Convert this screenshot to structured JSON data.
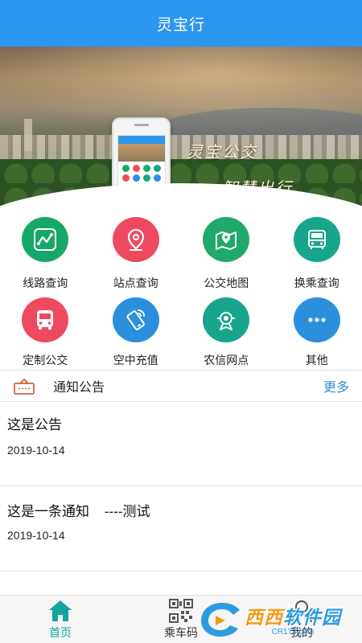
{
  "titlebar": {
    "title": "灵宝行"
  },
  "banner": {
    "line1": "灵宝公交",
    "line2": "智慧出行"
  },
  "grid": {
    "items": [
      {
        "label": "线路查询",
        "icon": "route-icon",
        "color": "#17a869"
      },
      {
        "label": "站点查询",
        "icon": "location-pin-icon",
        "color": "#ee4a5f"
      },
      {
        "label": "公交地图",
        "icon": "map-icon",
        "color": "#20a96a"
      },
      {
        "label": "换乘查询",
        "icon": "bus-transfer-icon",
        "color": "#17a58c"
      },
      {
        "label": "定制公交",
        "icon": "bus-icon",
        "color": "#ee4a5f"
      },
      {
        "label": "空中充值",
        "icon": "mobile-recharge-icon",
        "color": "#2b8fdc"
      },
      {
        "label": "农信网点",
        "icon": "bank-branch-icon",
        "color": "#17a58c"
      },
      {
        "label": "其他",
        "icon": "more-icon",
        "color": "#2b8fdc"
      }
    ]
  },
  "notices": {
    "header": "通知公告",
    "more": "更多",
    "items": [
      {
        "text": "这是公告",
        "date": "2019-10-14"
      },
      {
        "text": "这是一条通知    ----测试",
        "date": "2019-10-14"
      }
    ]
  },
  "tabbar": {
    "tabs": [
      {
        "label": "首页",
        "icon": "home-icon",
        "active": true
      },
      {
        "label": "乘车码",
        "icon": "qr-code-icon",
        "active": false
      },
      {
        "label": "我的",
        "icon": "profile-icon",
        "active": false
      }
    ]
  },
  "watermark": {
    "big_left": "西西",
    "big_right": "软件园",
    "small": "CR173.com"
  },
  "colors": {
    "primary": "#2b97ee",
    "accent_teal": "#14a3a0",
    "link": "#2b8fdc"
  }
}
